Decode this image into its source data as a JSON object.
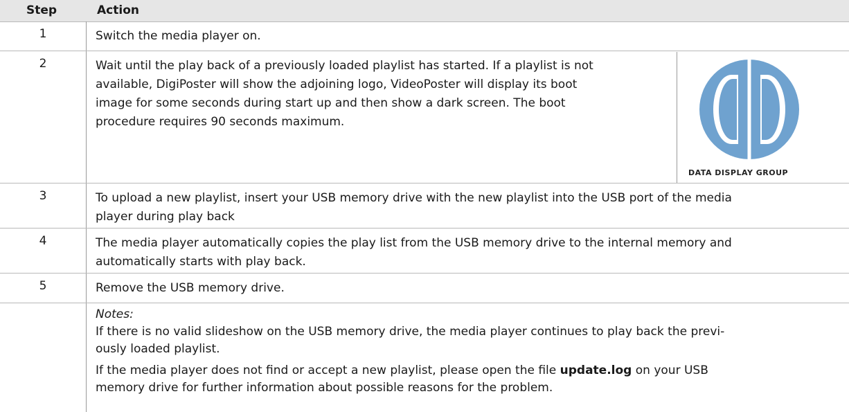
{
  "header": {
    "step": "Step",
    "action": "Action"
  },
  "rows": [
    {
      "step": "1",
      "lines": [
        "Switch the media player on."
      ]
    },
    {
      "step": "2",
      "lines": [
        "Wait until the play back of a previously loaded playlist has started. If a playlist is not",
        "available, DigiPoster will show the adjoining logo, VideoPoster will display its boot",
        "image for some seconds during start up and then show a dark screen. The boot",
        "procedure requires 90 seconds maximum."
      ]
    },
    {
      "step": "3",
      "lines": [
        "To upload a new playlist, insert your USB memory drive with the new playlist into the USB port of the media",
        "player during play back"
      ]
    },
    {
      "step": "4",
      "lines": [
        "The media player automatically copies the play list from the USB memory drive to the internal memory and",
        "automatically starts with play back."
      ]
    },
    {
      "step": "5",
      "lines": [
        "Remove the USB memory drive."
      ]
    }
  ],
  "notes": {
    "heading": "Notes:",
    "para1_line1": "If there is no valid slideshow on the USB memory drive, the media player continues to play back the previ-",
    "para1_line2": "ously loaded playlist.",
    "para2_line1_before": "If the media player does not find or accept a new playlist, please open the file ",
    "para2_filename": "update.log",
    "para2_line1_after": " on your USB",
    "para2_line2": "memory drive for further information about possible reasons for the problem."
  },
  "logo": {
    "caption": "DATA DISPLAY GROUP",
    "icon": "data-display-group-logo",
    "color": "#6fa2cf"
  }
}
